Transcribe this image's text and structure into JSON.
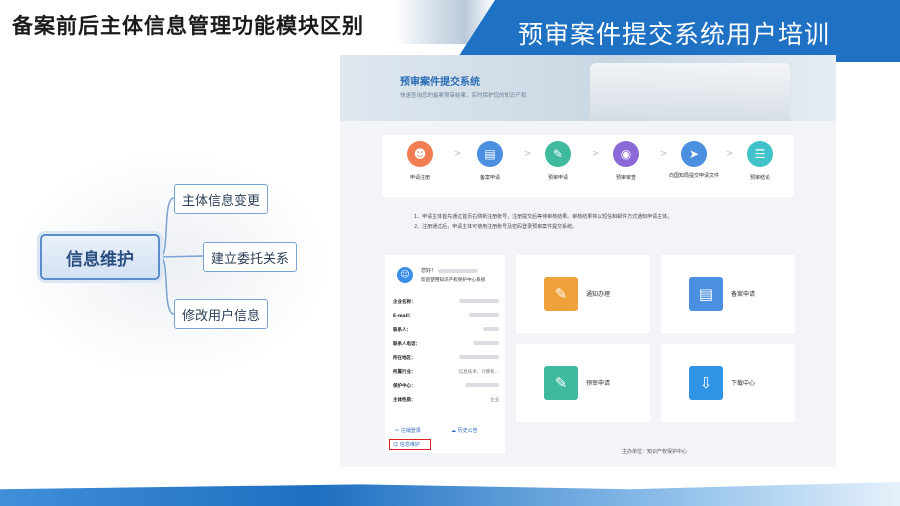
{
  "slide": {
    "title": "备案前后主体信息管理功能模块区别",
    "banner_title": "预审案件提交系统用户培训"
  },
  "mindmap": {
    "center": "信息维护",
    "nodes": [
      "主体信息变更",
      "建立委托关系",
      "修改用户信息"
    ]
  },
  "screenshot": {
    "banner_title": "预审案件提交系统",
    "banner_subtitle": "快速查询您的备案预审结果，实时保护您的知识产权",
    "steps": [
      {
        "label": "申请注册",
        "icon": "user-id-icon",
        "color": "#f07e52"
      },
      {
        "label": "备案申请",
        "icon": "folder-icon",
        "color": "#4a8fe0"
      },
      {
        "label": "预审申请",
        "icon": "document-edit-icon",
        "color": "#3fba9e"
      },
      {
        "label": "预审审查",
        "icon": "review-icon",
        "color": "#8b6ad8"
      },
      {
        "label": "向国知局提交申请文件",
        "icon": "send-icon",
        "color": "#4a8fe0"
      },
      {
        "label": "预审结论",
        "icon": "list-doc-icon",
        "color": "#3fc2c9"
      }
    ],
    "notes": [
      "1、申请主体首先通过首页右侧新注册账号，注册提交后等待审核结果。审核结果将以短信和邮件方式通知申请主体。",
      "2、注册通过后，申请主体可使用注册账号及密码登录预审案件提交系统。"
    ],
    "user": {
      "greeting": "您好！",
      "org": "欢迎使用知识产权保护中心系统",
      "fields": [
        {
          "label": "企业名称："
        },
        {
          "label": "E-mail："
        },
        {
          "label": "联系人："
        },
        {
          "label": "联系人电话："
        },
        {
          "label": "所在地区："
        },
        {
          "label": "所属行业：",
          "value": "信息技术、计算机..."
        },
        {
          "label": "保护中心："
        },
        {
          "label": "主体性质：",
          "value": "企业"
        }
      ],
      "link_register": "注销登录",
      "link_history": "历史公告",
      "link_info": "信息维护"
    },
    "functions": [
      {
        "label": "通知办理",
        "icon": "megaphone-icon",
        "color": "#f0a23a"
      },
      {
        "label": "备案申请",
        "icon": "folder-icon",
        "color": "#4a8fe0"
      },
      {
        "label": "预审申请",
        "icon": "document-edit-icon",
        "color": "#3fba9e"
      },
      {
        "label": "下载中心",
        "icon": "download-icon",
        "color": "#2f93e6"
      }
    ],
    "footer": "主办单位：知识产权保护中心"
  }
}
